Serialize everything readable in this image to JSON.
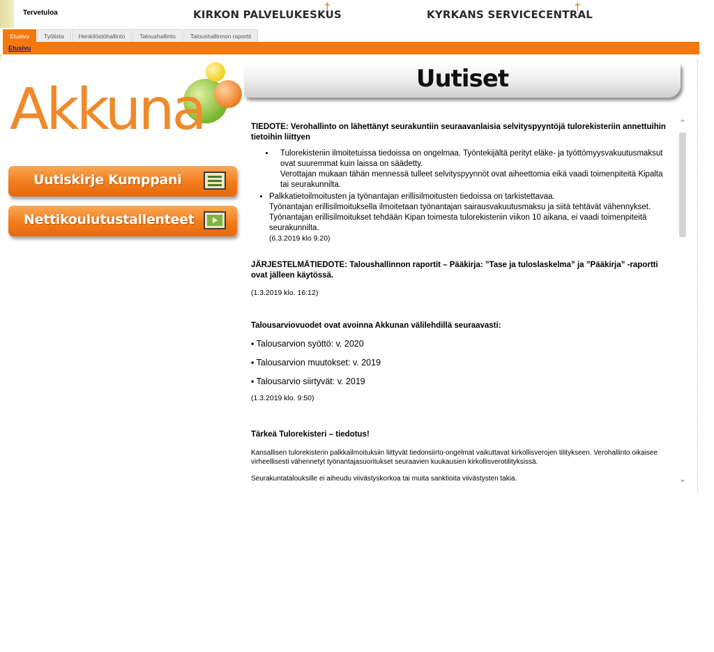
{
  "header": {
    "welcome": "Tervetuloa",
    "org_fi": "KIRKON PALVELUKESKUS",
    "org_sv": "KYRKANS SERVICECENTRAL",
    "cross_symbol": "†"
  },
  "tabs": [
    {
      "label": "Etusivu",
      "active": true
    },
    {
      "label": "Työlista",
      "active": false
    },
    {
      "label": "Henkilöstöhallinto",
      "active": false
    },
    {
      "label": "Taloushallinto",
      "active": false
    },
    {
      "label": "Taloushallinnon raportit",
      "active": false
    }
  ],
  "subnav": {
    "current": "Etusivu"
  },
  "logo": {
    "text": "Akkuna"
  },
  "buttons": {
    "newsletter": {
      "label": "Uutiskirje Kumppani",
      "icon": "newsletter-icon"
    },
    "recordings": {
      "label": "Nettikoulutustallenteet",
      "icon": "video-icon"
    }
  },
  "news": {
    "title": "Uutiset",
    "item1": {
      "heading": "TIEDOTE: Verohallinto on lähettänyt seurakuntiin seuraavanlaisia selvityspyyntöjä tulorekisteriin annettuihin tietoihin liittyen",
      "bullet1": "Tulorekisteriin ilmoitetuissa tiedoissa on ongelmaa. Työntekijältä perityt eläke- ja työttömyysvakuutusmaksut ovat suuremmat kuin laissa on säädetty.",
      "bullet1b": "Verottajan mukaan tähän mennessä tulleet selvityspyynnöt ovat aiheettomia eikä vaadi toimenpiteitä Kipalta tai seurakunnilta.",
      "bullet2": "Palkkatietoilmoitusten ja työnantajan erillisilmoitusten tiedoissa on tarkistettavaa.",
      "bullet2b": "Työnantajan erillisilmoituksella ilmoitetaan työnantajan sairausvakuutusmaksu ja siitä tehtävät vähennykset. Työnantajan erillisilmoitukset tehdään Kipan toimesta tulorekisteriin viikon 10 aikana, ei vaadi toimenpiteitä seurakunnilta.",
      "date": "(6.3.2019 klo 9.20)"
    },
    "item2": {
      "heading": "JÄRJESTELMÄTIEDOTE: Taloushallinnon raportit – Pääkirja: ”Tase ja tuloslaskelma” ja ”Pääkirja” -raportti ovat jälleen käytössä.",
      "date": "(1.3.2019 klo. 16:12)"
    },
    "item3": {
      "heading": "Talousarviovuodet ovat avoinna Akkunan välilehdillä seuraavasti:",
      "line1": "▪ Talousarvion syöttö: v. 2020",
      "line2": "▪ Talousarvion muutokset: v. 2019",
      "line3": "▪ Talousarvio siirtyvät: v. 2019",
      "date": "(1.3.2019 klo. 9:50)"
    },
    "item4": {
      "heading": "Tärkeä Tulorekisteri – tiedotus!",
      "para1": "Kansallisen tulorekisterin palkkailmoituksiin liittyvät tiedonsiirto-ongelmat vaikuttavat kirkollisverojen tilitykseen. Verohallinto oikaisee virheellisesti vähennetyt työnantajasuoritukset seuraavien kuukausien kirkollisverotilityksissä.",
      "para2": "Seurakuntatalouksille ei aiheudu viivästyskorkoa tai muita sanktioita viivästysten takia."
    }
  },
  "colors": {
    "accent": "#f4780a",
    "logo_orange": "#ef8a2a"
  }
}
